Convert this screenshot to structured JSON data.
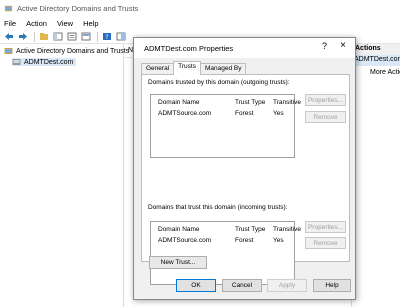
{
  "window": {
    "title": "Active Directory Domains and Trusts"
  },
  "menubar": [
    "File",
    "Action",
    "View",
    "Help"
  ],
  "tree": {
    "root": "Active Directory Domains and Trusts",
    "child": "ADMTDest.com"
  },
  "middle_header": "N",
  "actions": {
    "header": "Actions",
    "selected": "ADMTDest.com",
    "more": "More Actions"
  },
  "dialog": {
    "title": "ADMTDest.com Properties",
    "help_glyph": "?",
    "close_glyph": "×",
    "tabs": [
      "General",
      "Trusts",
      "Managed By"
    ],
    "active_tab": "Trusts",
    "outgoing": {
      "label": "Domains trusted by this domain (outgoing trusts):",
      "columns": [
        "Domain Name",
        "Trust Type",
        "Transitive"
      ],
      "rows": [
        {
          "domain": "ADMTSource.com",
          "type": "Forest",
          "transitive": "Yes"
        }
      ],
      "properties_button": "Properties...",
      "remove_button": "Remove"
    },
    "incoming": {
      "label": "Domains that trust this domain (incoming trusts):",
      "columns": [
        "Domain Name",
        "Trust Type",
        "Transitive"
      ],
      "rows": [
        {
          "domain": "ADMTSource.com",
          "type": "Forest",
          "transitive": "Yes"
        }
      ],
      "properties_button": "Properties...",
      "remove_button": "Remove"
    },
    "new_trust_button": "New Trust...",
    "footer": {
      "ok": "OK",
      "cancel": "Cancel",
      "apply": "Apply",
      "help": "Help"
    }
  }
}
